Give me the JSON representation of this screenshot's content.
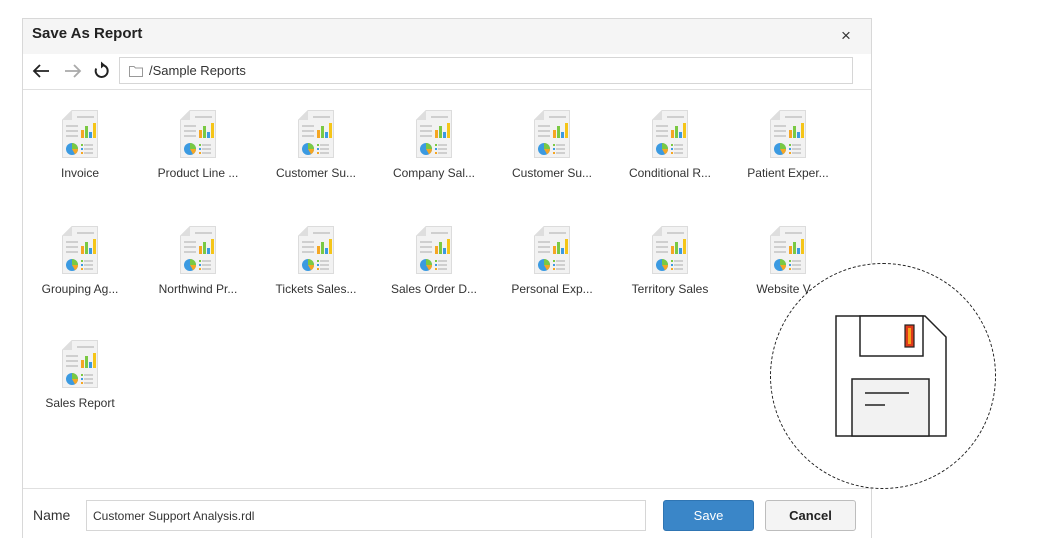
{
  "dialog": {
    "title": "Save As Report",
    "close_glyph": "×",
    "icons": {
      "close": "close-icon",
      "back": "arrow-left-icon",
      "forward": "arrow-right-icon",
      "refresh": "refresh-icon",
      "folder": "folder-icon",
      "report": "report-file-icon",
      "save_zoom": "floppy-disk-icon"
    }
  },
  "navbar": {
    "path": "/Sample Reports"
  },
  "files": [
    {
      "label": "Invoice"
    },
    {
      "label": "Product Line ..."
    },
    {
      "label": "Customer Su..."
    },
    {
      "label": "Company Sal..."
    },
    {
      "label": "Customer Su..."
    },
    {
      "label": "Conditional R..."
    },
    {
      "label": "Patient Exper..."
    },
    {
      "label": "Grouping Ag..."
    },
    {
      "label": "Northwind Pr..."
    },
    {
      "label": "Tickets Sales..."
    },
    {
      "label": "Sales Order D..."
    },
    {
      "label": "Personal Exp..."
    },
    {
      "label": "Territory Sales"
    },
    {
      "label": "Website V..."
    },
    {
      "label": "Sales Report"
    }
  ],
  "footer": {
    "name_label": "Name",
    "name_value": "Customer Support Analysis.rdl",
    "save_label": "Save",
    "cancel_label": "Cancel"
  },
  "colors": {
    "accent": "#3a86c8",
    "floppy_label": "#e03a1a"
  }
}
